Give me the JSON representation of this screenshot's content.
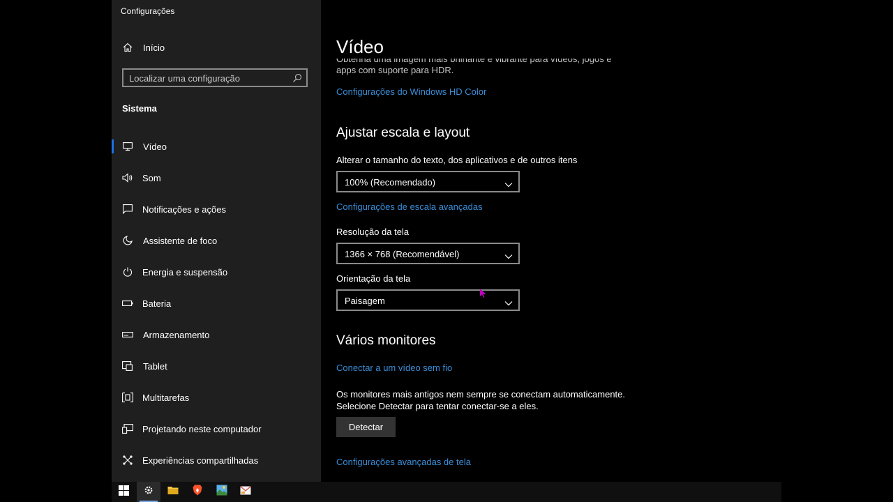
{
  "window": {
    "title": "Configurações"
  },
  "sidebar": {
    "home_label": "Início",
    "search": {
      "placeholder": "Localizar uma configuração"
    },
    "section_label": "Sistema",
    "items": [
      {
        "label": "Vídeo",
        "icon": "monitor-icon",
        "active": true
      },
      {
        "label": "Som",
        "icon": "speaker-icon"
      },
      {
        "label": "Notificações e ações",
        "icon": "message-icon"
      },
      {
        "label": "Assistente de foco",
        "icon": "moon-icon"
      },
      {
        "label": "Energia e suspensão",
        "icon": "power-icon"
      },
      {
        "label": "Bateria",
        "icon": "battery-icon"
      },
      {
        "label": "Armazenamento",
        "icon": "storage-icon"
      },
      {
        "label": "Tablet",
        "icon": "tablet-icon"
      },
      {
        "label": "Multitarefas",
        "icon": "multitask-icon"
      },
      {
        "label": "Projetando neste computador",
        "icon": "projector-icon"
      },
      {
        "label": "Experiências compartilhadas",
        "icon": "shared-icon"
      }
    ]
  },
  "main": {
    "title": "Vídeo",
    "hdr_text_line1": "Obtenha uma imagem mais brilhante e vibrante para vídeos, jogos e",
    "hdr_text_line2": "apps com suporte para HDR.",
    "hdr_link": "Configurações do Windows HD Color",
    "scale_heading": "Ajustar escala e layout",
    "scale_label": "Alterar o tamanho do texto, dos aplicativos e de outros itens",
    "scale_value": "100% (Recomendado)",
    "scale_link": "Configurações de escala avançadas",
    "resolution_label": "Resolução da tela",
    "resolution_value": "1366 × 768 (Recomendável)",
    "orientation_label": "Orientação da tela",
    "orientation_value": "Paisagem",
    "monitors_heading": "Vários monitores",
    "wireless_link": "Conectar a um vídeo sem fio",
    "detect_text_line1": "Os monitores mais antigos nem sempre se conectam automaticamente.",
    "detect_text_line2": "Selecione Detectar para tentar conectar-se a eles.",
    "detect_button": "Detectar",
    "advanced_link": "Configurações avançadas de tela"
  },
  "taskbar": {
    "items": [
      "windows-start-icon",
      "settings-gear-icon",
      "file-explorer-icon",
      "brave-browser-icon",
      "photos-app-icon",
      "mail-app-icon"
    ]
  },
  "colors": {
    "accent": "#1a73e8",
    "link": "#3b8ed8",
    "sidebar_bg": "#1f1f1f",
    "cursor": "#c000c0"
  }
}
